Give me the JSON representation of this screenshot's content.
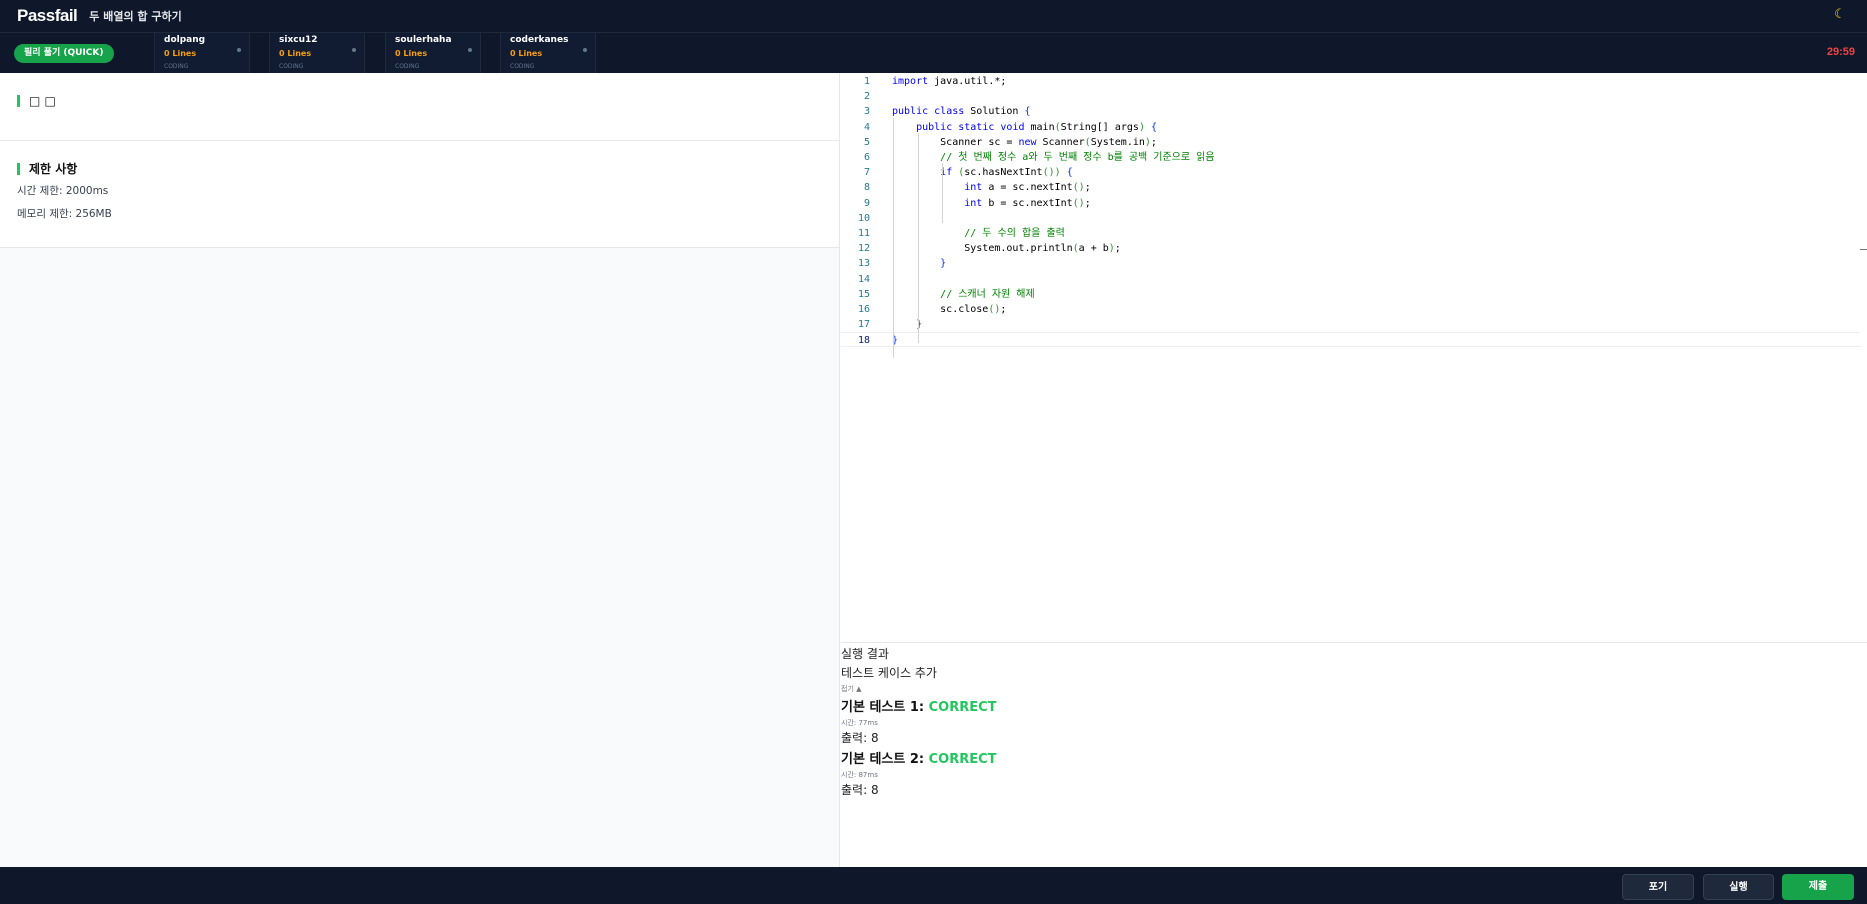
{
  "app": {
    "brand": "Passfail",
    "problem_title": "두 배열의 합 구하기",
    "theme_icon": "moon-icon"
  },
  "userbar": {
    "quick_leave_label": "필리 풀기 (QUICK)",
    "timer": "29:59",
    "users": [
      {
        "name": "dolpang",
        "lines": "0 Lines",
        "status": "CODING"
      },
      {
        "name": "sixcu12",
        "lines": "0 Lines",
        "status": "CODING"
      },
      {
        "name": "soulerhaha",
        "lines": "0 Lines",
        "status": "CODING"
      },
      {
        "name": "coderkanes",
        "lines": "0 Lines",
        "status": "CODING"
      }
    ]
  },
  "problem": {
    "desc_title": "□ □",
    "limits_title": "제한 사항",
    "time_limit": "시간 제한: 2000ms",
    "memory_limit": "메모리 제한: 256MB"
  },
  "editor": {
    "active_line": 18,
    "lines": [
      "import java.util.*;",
      "",
      "public class Solution {",
      "    public static void main(String[] args) {",
      "        Scanner sc = new Scanner(System.in);",
      "        // 첫 번째 정수 a와 두 번째 정수 b를 공백 기준으로 읽음",
      "        if (sc.hasNextInt()) {",
      "            int a = sc.nextInt();",
      "            int b = sc.nextInt();",
      "",
      "            // 두 수의 합을 출력",
      "            System.out.println(a + b);",
      "        }",
      "",
      "        // 스캐너 자원 해제",
      "        sc.close();",
      "    }",
      "}"
    ]
  },
  "results": {
    "header": "실행 결과",
    "add_testcase": "테스트 케이스 추가",
    "collapse": "접기 ▲",
    "tests": [
      {
        "title": "기본 테스트 1: ",
        "status": "CORRECT",
        "time": "시간: 77ms",
        "output": "출력: 8"
      },
      {
        "title": "기본 테스트 2: ",
        "status": "CORRECT",
        "time": "시간: 87ms",
        "output": "출력: 8"
      }
    ]
  },
  "actions": {
    "give_up": "포기",
    "run": "실행",
    "submit": "제출"
  },
  "colors": {
    "topbar": "#0f172a",
    "accent_green": "#16a34a",
    "correct": "#22c55e",
    "timer_red": "#ef4444",
    "lines_orange": "#f59e0b"
  }
}
